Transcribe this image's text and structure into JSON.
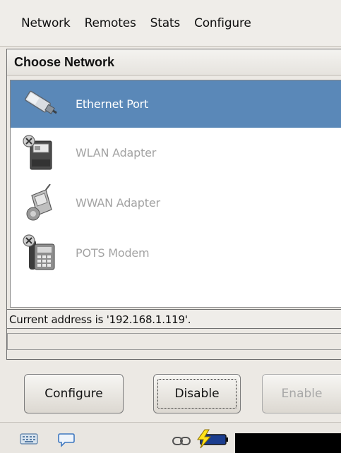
{
  "menubar": {
    "items": [
      "Network",
      "Remotes",
      "Stats",
      "Configure"
    ]
  },
  "panel": {
    "title": "Choose Network",
    "items": [
      {
        "label": "Ethernet Port",
        "icon": "ethernet-cable-icon",
        "selected": true
      },
      {
        "label": "WLAN Adapter",
        "icon": "wlan-card-icon",
        "selected": false
      },
      {
        "label": "WWAN Adapter",
        "icon": "wwan-phone-icon",
        "selected": false
      },
      {
        "label": "POTS Modem",
        "icon": "telephone-modem-icon",
        "selected": false
      }
    ],
    "status": "Current address is '192.168.1.119'.",
    "status2": ""
  },
  "buttons": {
    "configure": "Configure",
    "disable": "Disable",
    "enable": "Enable"
  },
  "taskbar": {
    "icons": [
      "keyboard-icon",
      "speech-bubble-icon",
      "link-icon",
      "battery-charging-icon"
    ]
  },
  "colors": {
    "selection": "#5a88b8",
    "disabled_text": "#a3a3a3",
    "background": "#ece9e4"
  }
}
